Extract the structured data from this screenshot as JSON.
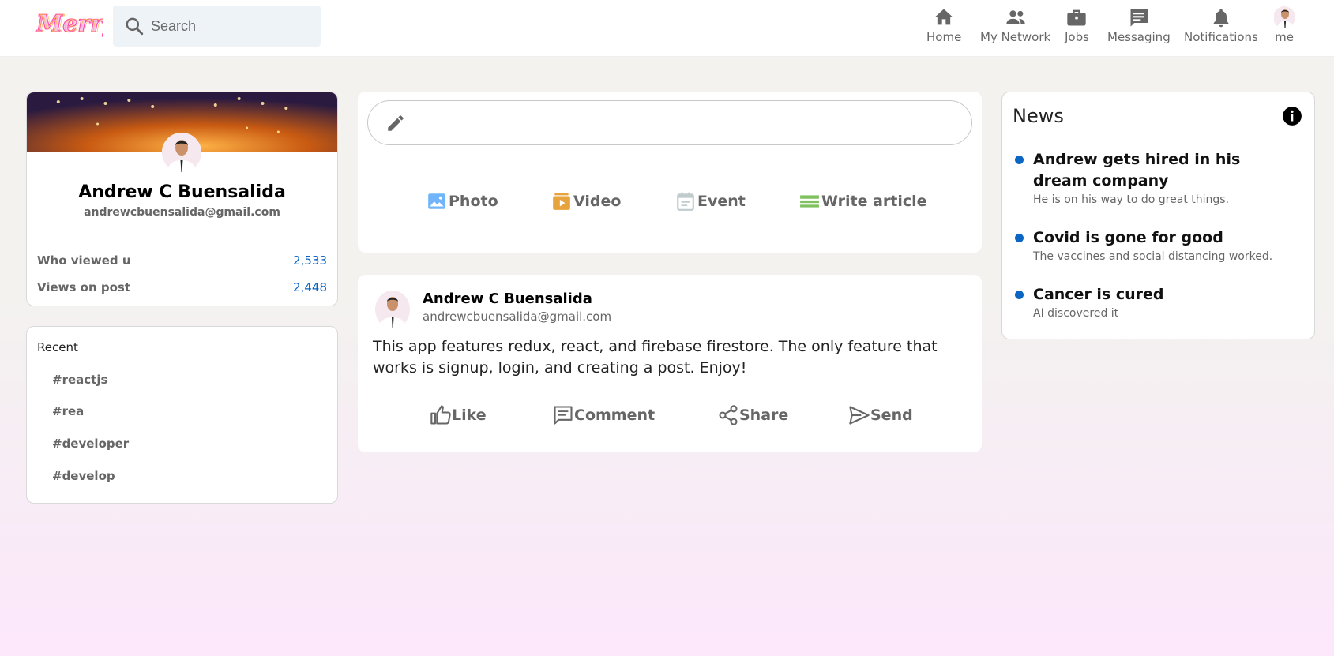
{
  "app": {
    "logo_text": "Merry"
  },
  "search": {
    "placeholder": "Search"
  },
  "nav": [
    {
      "label": "Home",
      "icon": "home-icon"
    },
    {
      "label": "My Network",
      "icon": "network-icon"
    },
    {
      "label": "Jobs",
      "icon": "briefcase-icon"
    },
    {
      "label": "Messaging",
      "icon": "chat-icon"
    },
    {
      "label": "Notifications",
      "icon": "bell-icon"
    },
    {
      "label": "me",
      "icon": "avatar"
    }
  ],
  "profile": {
    "name": "Andrew C Buensalida",
    "email": "andrewcbuensalida@gmail.com",
    "stats": [
      {
        "label": "Who viewed u",
        "value": "2,533"
      },
      {
        "label": "Views on post",
        "value": "2,448"
      }
    ]
  },
  "recent": {
    "title": "Recent",
    "tags": [
      "#reactjs",
      "#rea",
      "#developer",
      "#develop"
    ]
  },
  "composer": {
    "options": [
      {
        "label": "Photo",
        "icon": "photo-icon",
        "color": "#70b5f9"
      },
      {
        "label": "Video",
        "icon": "video-icon",
        "color": "#e7a33e"
      },
      {
        "label": "Event",
        "icon": "calendar-icon",
        "color": "#c0cbcd"
      },
      {
        "label": "Write article",
        "icon": "article-icon",
        "color": "#7fc15e"
      }
    ]
  },
  "post": {
    "name": "Andrew C Buensalida",
    "email": "andrewcbuensalida@gmail.com",
    "message": "This app features redux, react, and firebase firestore. The only feature that works is signup, login, and creating a post. Enjoy!",
    "actions": [
      {
        "label": "Like",
        "icon": "thumbs-up-icon"
      },
      {
        "label": "Comment",
        "icon": "comment-icon"
      },
      {
        "label": "Share",
        "icon": "share-icon"
      },
      {
        "label": "Send",
        "icon": "send-icon"
      }
    ]
  },
  "news": {
    "title": "News",
    "items": [
      {
        "headline": "Andrew gets hired in his dream company",
        "sub": "He is on his way to do great things."
      },
      {
        "headline": "Covid is gone for good",
        "sub": "The vaccines and social distancing worked."
      },
      {
        "headline": "Cancer is cured",
        "sub": "AI discovered it"
      }
    ]
  },
  "colors": {
    "accent": "#0a66c2",
    "icon_gray": "#666666"
  }
}
